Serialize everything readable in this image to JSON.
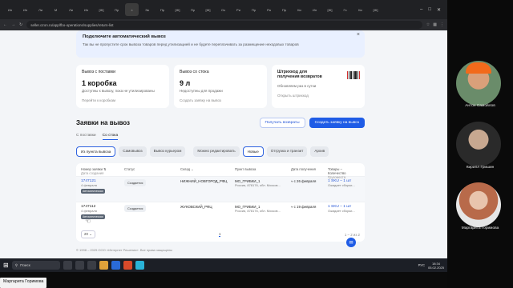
{
  "browser": {
    "url": "seller.ozon.ru/app/fbo-operations/supplies/return-list",
    "tabs": [
      {
        "label": "Ин",
        "active": false
      },
      {
        "label": "Ин",
        "active": false
      },
      {
        "label": "Ли",
        "active": false
      },
      {
        "label": "M",
        "active": false
      },
      {
        "label": "Ли",
        "active": false
      },
      {
        "label": "Ин",
        "active": false
      },
      {
        "label": "[Ж]",
        "active": false
      },
      {
        "label": "Пр",
        "active": false
      },
      {
        "label": "×",
        "active": true
      },
      {
        "label": "Зв",
        "active": false
      },
      {
        "label": "Пр",
        "active": false
      },
      {
        "label": "[Ж]",
        "active": false
      },
      {
        "label": "Пр",
        "active": false
      },
      {
        "label": "[Ж]",
        "active": false
      },
      {
        "label": "Оз",
        "active": false
      },
      {
        "label": "Ри",
        "active": false
      },
      {
        "label": "Пр",
        "active": false
      },
      {
        "label": "Ра",
        "active": false
      },
      {
        "label": "Пр",
        "active": false
      },
      {
        "label": "Ки",
        "active": false
      },
      {
        "label": "Ин",
        "active": false
      },
      {
        "label": "[Ж]",
        "active": false
      },
      {
        "label": "Гз",
        "active": false
      },
      {
        "label": "Ки",
        "active": false
      },
      {
        "label": "[Ж]",
        "active": false
      }
    ],
    "controls": [
      "–",
      "□",
      "✕"
    ]
  },
  "banner": {
    "title": "Подключите автоматический вывоз",
    "text": "Так вы не пропустите срок вывоза товаров перед утилизацией и не будете переплачивать за размещение неходовых товаров"
  },
  "cards": [
    {
      "title": "Вывоз с поставки",
      "value": "1 коробка",
      "sub": "Доступны к вывозу, пока не утилизированы",
      "link": "Перейти к коробкам"
    },
    {
      "title": "Вывоз со стока",
      "value": "9 л",
      "sub": "Недоступны для продажи",
      "link": "Создать заявку на вывоз"
    },
    {
      "title": "Штрихкод для получения возвратов",
      "value": "",
      "sub": "Обновляем раз в сутки",
      "link": "Открыть штрихкод"
    }
  ],
  "section": {
    "title": "Заявки на вывоз",
    "btn_receive": "Получать возвраты",
    "btn_create": "Создать заявку на вывоз"
  },
  "subtabs": [
    {
      "label": "С поставки",
      "active": false
    },
    {
      "label": "Со стока",
      "active": true
    }
  ],
  "filters": [
    {
      "label": "Из пункта вывоза",
      "selected": true
    },
    {
      "label": "Самовывоз",
      "selected": false
    },
    {
      "label": "Вывоз курьером",
      "selected": false
    },
    {
      "label": "Можно редактировать",
      "selected": false
    },
    {
      "label": "Новые",
      "selected": true
    },
    {
      "label": "Отгрузка и транзит",
      "selected": false
    },
    {
      "label": "Архив",
      "selected": false
    }
  ],
  "table": {
    "headers": [
      {
        "main": "Номер заявки ⇅",
        "sub": "Дата создания"
      },
      {
        "main": "Статус",
        "sub": ""
      },
      {
        "main": "Склад ⌄",
        "sub": ""
      },
      {
        "main": "Пункт вывоза",
        "sub": ""
      },
      {
        "main": "Дата получения",
        "sub": ""
      },
      {
        "main": "Товары – Количество",
        "sub": "Грузоместа"
      }
    ],
    "rows": [
      {
        "num": "1747121",
        "date": "4 февраля",
        "tag": "Автоматическая",
        "status": "Создается",
        "warehouse": "НИЖНИЙ_НОВГОРОД_РФЦ",
        "point": "МО_ГРИБКИ_1",
        "point_addr": "Россия, 878176, обл. Москов...",
        "recv": "≈ с 26 февраля",
        "goods": "1 SKU – 1 шт",
        "goods_sub": "Ожидает сборки..."
      },
      {
        "num": "1747112",
        "date": "4 февраля",
        "tag": "Автоматическая",
        "status": "Создается",
        "warehouse": "ЖУКОВСКИЙ_РФЦ",
        "point": "МО_ГРИБКИ_1",
        "point_addr": "Россия, 878176, обл. Москов...",
        "recv": "≈ с 19 февраля",
        "goods": "1 SKU – 1 шт",
        "goods_sub": "Ожидает сборки..."
      }
    ],
    "per_page": "20 ⌄",
    "page": "1",
    "page_info": "1 – 2 из 2"
  },
  "footer": "© 1998 – 2025 ООО «Интернет Решения». Все права защищены",
  "taskbar": {
    "search": "Поиск",
    "lang": "РУС",
    "time": "18:34",
    "date": "05.02.2025"
  },
  "participants": [
    {
      "name": "Антон Самойлов"
    },
    {
      "name": "Кирилл Гришин"
    },
    {
      "name": "Маргарита Горимова"
    }
  ],
  "share_label": "Маргарита Горимова"
}
